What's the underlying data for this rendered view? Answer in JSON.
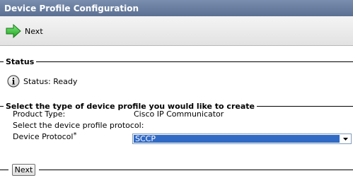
{
  "window": {
    "title": "Device Profile Configuration"
  },
  "toolbar": {
    "next_label": "Next",
    "next_icon": "right-arrow-icon"
  },
  "status": {
    "legend": "Status",
    "icon": "info-icon",
    "text": "Status: Ready"
  },
  "profile": {
    "legend": "Select the type of device profile you would like to create",
    "product_type_label": "Product Type:",
    "product_type_value": "Cisco IP Communicator",
    "protocol_prompt": "Select the device profile protocol:",
    "device_protocol_label": "Device Protocol",
    "required_marker": "*",
    "device_protocol_value": "SCCP"
  },
  "footer": {
    "next_button": "Next"
  },
  "colors": {
    "titlebar": "#5a6f92",
    "arrow": "#33cc33",
    "selection": "#316ac5"
  }
}
